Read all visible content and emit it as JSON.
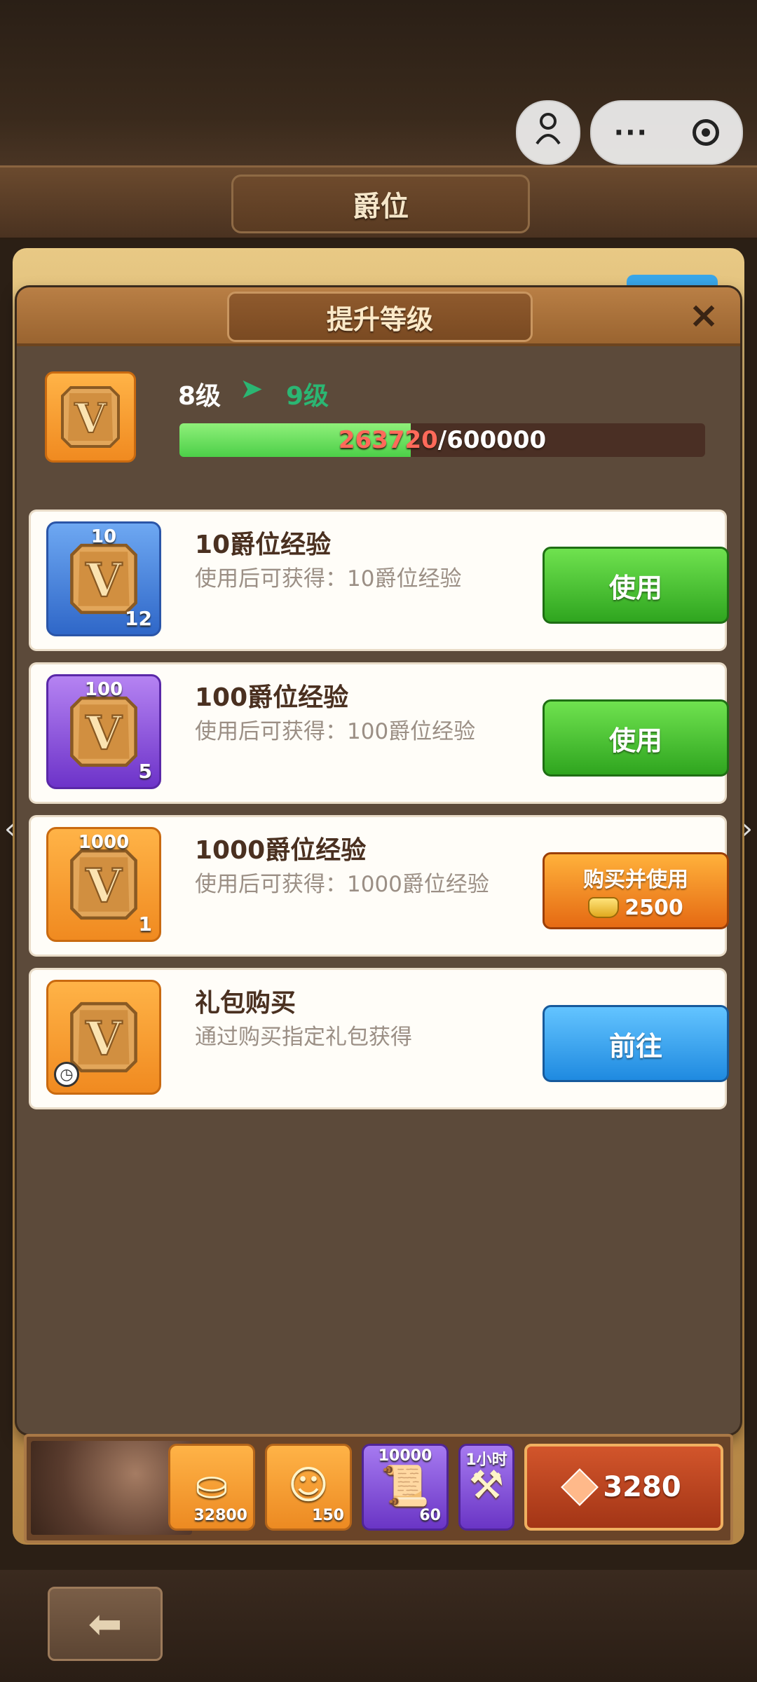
{
  "page": {
    "title": "爵位"
  },
  "modal": {
    "title": "提升等级",
    "close_icon": "×"
  },
  "rank": {
    "current_level": "8级",
    "next_level": "9级",
    "arrow_icon": "➤",
    "exp_current": "263720",
    "exp_total": "/600000",
    "exp_progress": 0.4395
  },
  "items": [
    {
      "name": "10爵位经验",
      "desc": "使用后可获得：10爵位经验",
      "badge": "10",
      "count": "12",
      "button": "使用"
    },
    {
      "name": "100爵位经验",
      "desc": "使用后可获得：100爵位经验",
      "badge": "100",
      "count": "5",
      "button": "使用"
    },
    {
      "name": "1000爵位经验",
      "desc": "使用后可获得：1000爵位经验",
      "badge": "1000",
      "count": "1",
      "button": "购买并使用",
      "price": "2500"
    },
    {
      "name": "礼包购买",
      "desc": "通过购买指定礼包获得",
      "button": "前往"
    }
  ],
  "resources": {
    "gold": "32800",
    "hero_shards": "150",
    "scroll_top": "10000",
    "scroll_count": "60",
    "hammer_top": "1小时",
    "gems": "3280"
  },
  "icons": {
    "rank_token": "V",
    "back": "⬅",
    "capsule_more": "···"
  },
  "colors": {
    "green_button": "#2fa51f",
    "orange_button": "#e56a13",
    "blue_button": "#1f8ae0",
    "exp_fill": "#4ccf48",
    "exp_current": "#ff6a5a",
    "next_level": "#2bb673"
  }
}
